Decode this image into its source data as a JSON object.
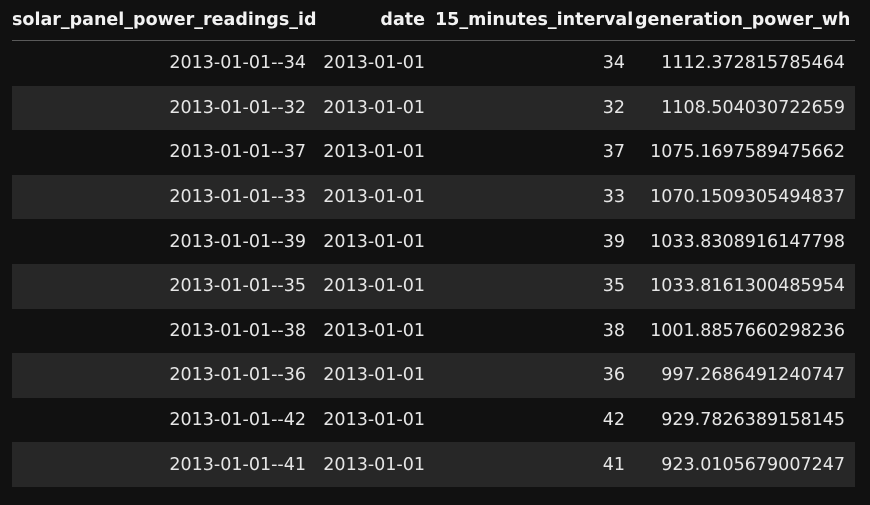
{
  "table": {
    "columns": [
      "solar_panel_power_readings_id",
      "date",
      "15_minutes_interval",
      "generation_power_wh"
    ],
    "rows": [
      [
        "2013-01-01--34",
        "2013-01-01",
        "34",
        "1112.372815785464"
      ],
      [
        "2013-01-01--32",
        "2013-01-01",
        "32",
        "1108.504030722659"
      ],
      [
        "2013-01-01--37",
        "2013-01-01",
        "37",
        "1075.1697589475662"
      ],
      [
        "2013-01-01--33",
        "2013-01-01",
        "33",
        "1070.1509305494837"
      ],
      [
        "2013-01-01--39",
        "2013-01-01",
        "39",
        "1033.8308916147798"
      ],
      [
        "2013-01-01--35",
        "2013-01-01",
        "35",
        "1033.8161300485954"
      ],
      [
        "2013-01-01--38",
        "2013-01-01",
        "38",
        "1001.8857660298236"
      ],
      [
        "2013-01-01--36",
        "2013-01-01",
        "36",
        "997.2686491240747"
      ],
      [
        "2013-01-01--42",
        "2013-01-01",
        "42",
        "929.7826389158145"
      ],
      [
        "2013-01-01--41",
        "2013-01-01",
        "41",
        "923.0105679007247"
      ]
    ]
  }
}
